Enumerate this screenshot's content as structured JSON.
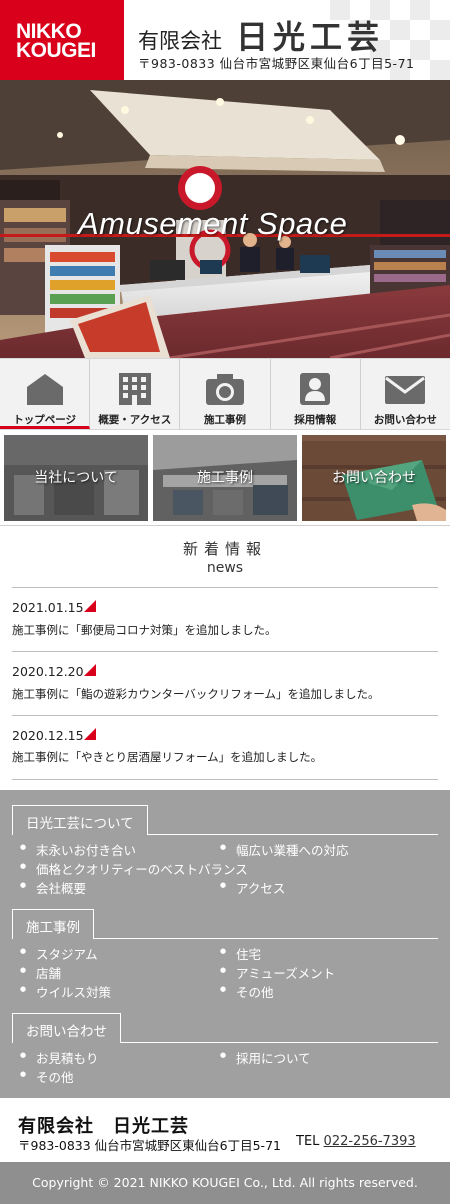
{
  "header": {
    "logo_line1": "NIKKO",
    "logo_line2": "KOUGEI",
    "company_kind": "有限会社",
    "company_name": "日光工芸",
    "address": "〒983-0833 仙台市宮城野区東仙台6丁目5-71"
  },
  "hero": {
    "title": "Amusement Space"
  },
  "nav": {
    "items": [
      {
        "label": "トップページ",
        "icon": "home-icon"
      },
      {
        "label": "概要・アクセス",
        "icon": "building-icon"
      },
      {
        "label": "施工事例",
        "icon": "camera-icon"
      },
      {
        "label": "採用情報",
        "icon": "person-card-icon"
      },
      {
        "label": "お問い合わせ",
        "icon": "mail-icon"
      }
    ]
  },
  "tiles": [
    {
      "label": "当社について"
    },
    {
      "label": "施工事例"
    },
    {
      "label": "お問い合わせ"
    }
  ],
  "news": {
    "title": "新着情報",
    "subtitle": "news",
    "items": [
      {
        "date": "2021.01.15",
        "text": "施工事例に「郵便局コロナ対策」を追加しました。"
      },
      {
        "date": "2020.12.20",
        "text": "施工事例に「鮨の遊彩カウンターバックリフォーム」を追加しました。"
      },
      {
        "date": "2020.12.15",
        "text": "施工事例に「やきとり居酒屋リフォーム」を追加しました。"
      }
    ]
  },
  "links": {
    "about": {
      "heading": "日光工芸について",
      "items": [
        "末永いお付き合い",
        "幅広い業種への対応",
        "価格とクオリティーのベストバランス",
        "会社概要",
        "アクセス"
      ]
    },
    "works": {
      "heading": "施工事例",
      "items": [
        "スタジアム",
        "住宅",
        "店舗",
        "アミューズメント",
        "ウイルス対策",
        "その他"
      ]
    },
    "contact": {
      "heading": "お問い合わせ",
      "items": [
        "お見積もり",
        "採用について",
        "その他"
      ]
    }
  },
  "footer": {
    "company": "有限会社　日光工芸",
    "address": "〒983-0833 仙台市宮城野区東仙台6丁目5-71",
    "tel_label": "TEL",
    "tel": "022-256-7393",
    "copyright": "Copyright © 2021 NIKKO KOUGEI Co., Ltd. All rights reserved."
  },
  "colors": {
    "brand_red": "#d9001b",
    "footer_gray": "#a0a0a0",
    "copyright_gray": "#8f8f8f"
  }
}
